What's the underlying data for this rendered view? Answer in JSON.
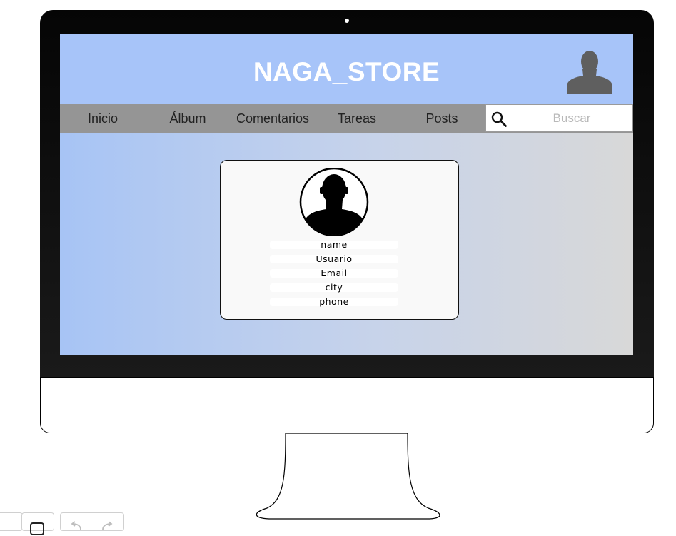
{
  "site": {
    "title": "NAGA_STORE"
  },
  "nav": {
    "items": [
      {
        "label": "Inicio"
      },
      {
        "label": "Álbum"
      },
      {
        "label": "Comentarios"
      },
      {
        "label": "Tareas"
      },
      {
        "label": "Posts"
      }
    ]
  },
  "search": {
    "placeholder": "Buscar",
    "icon": "search-icon"
  },
  "profile": {
    "fields": {
      "name": "name",
      "user": "Usuario",
      "email": "Email",
      "city": "city",
      "phone": "phone"
    }
  },
  "colors": {
    "header": "#a7c4f9",
    "nav": "#959595",
    "bezel": "#050505",
    "gradient_start": "#a7c4f5",
    "gradient_end": "#d8d8d8"
  }
}
